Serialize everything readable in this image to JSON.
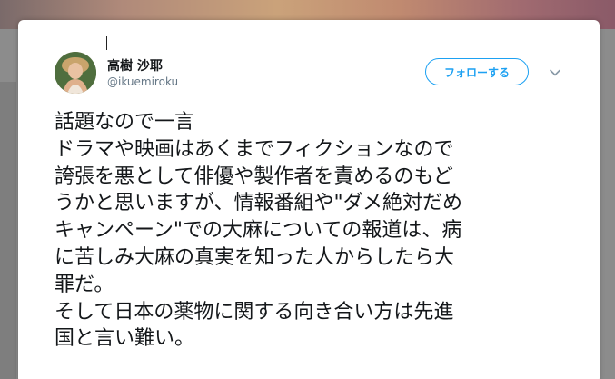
{
  "tweet": {
    "display_name": "高樹 沙耶",
    "handle": "@ikuemiroku",
    "follow_label": "フォローする",
    "text": "話題なので一言\nドラマや映画はあくまでフィクションなので\n誇張を悪として俳優や製作者を責めるのもど\nうかと思いますが、情報番組や\"ダメ絶対だめ\nキャンペーン\"での大麻についての報道は、病\nに苦しみ大麻の真実を知った人からしたら大\n罪だ。\nそして日本の薬物に関する向き合い方は先進\n国と言い難い。"
  },
  "icons": {
    "menu": "chevron-down-icon",
    "avatar": "profile-avatar"
  },
  "colors": {
    "accent": "#1da1f2",
    "text": "#14171a",
    "muted": "#657786"
  }
}
